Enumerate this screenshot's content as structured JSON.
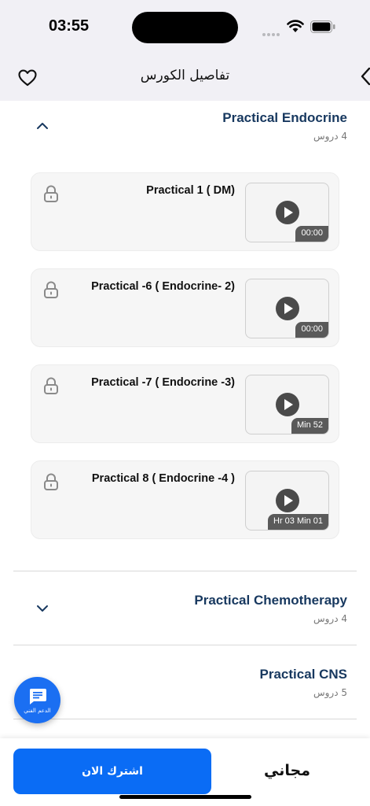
{
  "status": {
    "time": "03:55"
  },
  "header": {
    "title": "تفاصيل الكورس"
  },
  "sections": [
    {
      "title": "Practical Endocrine",
      "subtitle": "4 دروس",
      "expanded": true,
      "lessons": [
        {
          "title": "Practical 1 ( DM)",
          "duration": "00:00",
          "locked": true
        },
        {
          "title": "Practical -6 ( Endocrine- 2)",
          "duration": "00:00",
          "locked": true
        },
        {
          "title": "Practical -7 ( Endocrine -3)",
          "duration": "Min 52",
          "locked": true
        },
        {
          "title": "Practical 8 ( Endocrine -4 )",
          "duration": "Hr 03 Min 01",
          "locked": true
        }
      ]
    },
    {
      "title": "Practical Chemotherapy",
      "subtitle": "4 دروس",
      "expanded": false
    },
    {
      "title": "Practical CNS",
      "subtitle": "5 دروس",
      "expanded": false
    }
  ],
  "support": {
    "label": "الدعم الفني"
  },
  "footer": {
    "price_label": "مجاني",
    "subscribe_label": "اشترك الان"
  },
  "colors": {
    "accent": "#0a6cf5",
    "section_title": "#17385f",
    "support_bg": "#1b6ff2"
  }
}
